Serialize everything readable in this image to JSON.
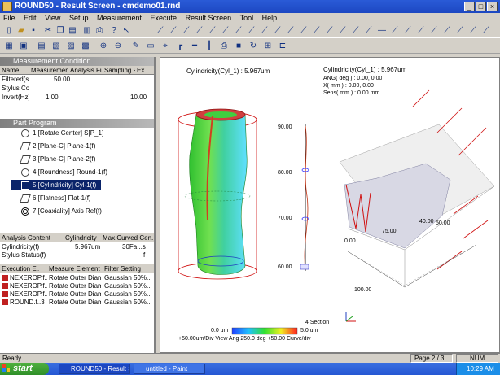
{
  "window": {
    "title": "ROUND50 - Result Screen - cmdemo01.rnd"
  },
  "menu": [
    "File",
    "Edit",
    "View",
    "Setup",
    "Measurement",
    "Execute",
    "Result Screen",
    "Tool",
    "Help"
  ],
  "measurement_condition": {
    "header": "Measurement Condition",
    "columns": [
      "Name",
      "Measurement ...",
      "Analysis Fun...",
      "Sampling P...",
      "Ex..."
    ],
    "rows": [
      [
        "Filtered(s)",
        "50.00",
        "",
        "",
        ""
      ],
      [
        "Stylus Cor...",
        "",
        "",
        "",
        ""
      ],
      [
        "Invert(Hz)",
        "1.00",
        "",
        "10.00",
        ""
      ]
    ]
  },
  "part_program": {
    "header": "Part Program",
    "items": [
      "1:[Rotate Center] S[P_1]",
      "2:[Plane-C] Plane-1(f)",
      "3:[Plane-C] Plane-2(f)",
      "4:[Roundness] Round-1(f)",
      "5:[Cylindricity] Cyl-1(f)",
      "6:[Flatness] Flat-1(f)",
      "7:[Coaxiality] Axis Ref(f)"
    ]
  },
  "analysis_table": {
    "columns": [
      "Analysis Contents",
      "Cylindricity",
      "Max.Curved Cen..."
    ],
    "rows": [
      [
        "Cylindricity(f)",
        "5.967um",
        "30Fa...s"
      ],
      [
        "Stylus Status(f)",
        "",
        "f"
      ]
    ]
  },
  "execution_table": {
    "columns": [
      "Execution E...",
      "Measure Element",
      "Filter Setting"
    ],
    "rows": [
      [
        "NEXEROP.f..0",
        "Rotate Outer Diam.",
        "Gaussian 50%..."
      ],
      [
        "NEXEROP.f..1",
        "Rotate Outer Diam.",
        "Gaussian 50%..."
      ],
      [
        "NEXEROP.f..2",
        "Rotate Outer Diam.",
        "Gaussian 50%..."
      ],
      [
        "ROUND.f..3",
        "Rotate Outer Diam.",
        "Gaussian 50%..."
      ]
    ]
  },
  "view": {
    "left_title": "Cylindricity(Cyl_1) : 5.967um",
    "right_title": "Cylindricity(Cyl_1) : 5.967um",
    "right_info": [
      "ANG( deg ) : 0.00, 0.00",
      "X( mm ) : 0.00, 0.00",
      "Sens( mm ) : 0.00 mm"
    ],
    "axis_labels": [
      "90.00",
      "80.00",
      "70.00",
      "60.00"
    ],
    "surface_labels": [
      "0.00",
      "75.00",
      "100.00",
      "50.00",
      "40.00"
    ],
    "colorbar_min": "0.0 um",
    "colorbar_max": "5.0 um",
    "footer": "+50.00um/Div  View Ang 250.0 deg  +50.00 Curve/div",
    "section_label": "4 Section",
    "accent_red": "#d01010",
    "surface_green": "#40d040",
    "surface_cyan": "#60e0ff"
  },
  "status": {
    "left": "Ready",
    "page": "Page 2 / 3",
    "mode": "NUM"
  },
  "taskbar": {
    "start": "start",
    "items": [
      "ROUND50 - Result Scr...",
      "untitled - Paint"
    ],
    "clock": "10:29 AM"
  }
}
